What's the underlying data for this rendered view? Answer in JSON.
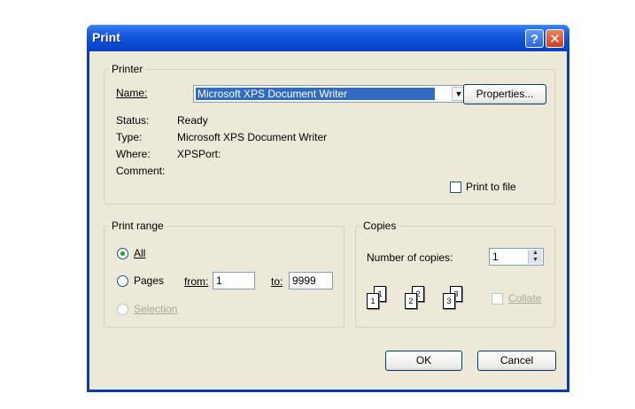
{
  "window": {
    "title": "Print",
    "help_icon": "?",
    "close_icon": "✕"
  },
  "printer": {
    "legend": "Printer",
    "name_label": "Name:",
    "name_value": "Microsoft XPS Document Writer",
    "properties_button": "Properties...",
    "status_label": "Status:",
    "status_value": "Ready",
    "type_label": "Type:",
    "type_value": "Microsoft XPS Document Writer",
    "where_label": "Where:",
    "where_value": "XPSPort:",
    "comment_label": "Comment:",
    "print_to_file_label": "Print to file",
    "print_to_file_checked": false
  },
  "print_range": {
    "legend": "Print range",
    "all_label": "All",
    "pages_label": "Pages",
    "from_label": "from:",
    "from_value": "1",
    "to_label": "to:",
    "to_value": "9999",
    "selection_label": "Selection",
    "selected": "All"
  },
  "copies": {
    "legend": "Copies",
    "number_label": "Number of copies:",
    "number_value": "1",
    "collate_label": "Collate",
    "collate_checked": false,
    "collate_pages": [
      "1",
      "1",
      "2",
      "2",
      "3",
      "3"
    ]
  },
  "actions": {
    "ok": "OK",
    "cancel": "Cancel"
  }
}
